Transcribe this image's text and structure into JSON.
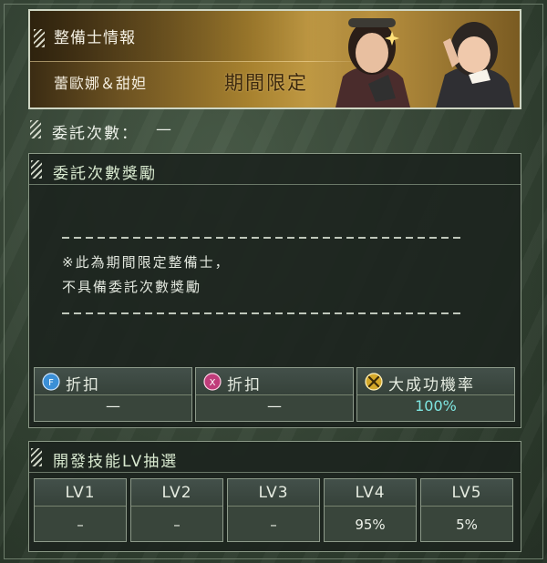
{
  "header": {
    "title": "整備士情報",
    "name": "蕾歐娜＆甜妲",
    "limited_tag": "期間限定"
  },
  "commission": {
    "label": "委託次數：",
    "value": "—"
  },
  "reward": {
    "title": "委託次數獎勵",
    "note_line1": "※此為期間限定整備士，",
    "note_line2": "不具備委託次數獎勵",
    "perks": [
      {
        "icon": "fp-discount-icon",
        "label": "折扣",
        "value": "—",
        "icon_color": "#3b8fd6"
      },
      {
        "icon": "fx-discount-icon",
        "label": "折扣",
        "value": "—",
        "icon_color": "#c03c7a"
      },
      {
        "icon": "tools-success-icon",
        "label": "大成功機率",
        "value": "100%",
        "icon_color": "#d4a82a"
      }
    ]
  },
  "skill_lottery": {
    "title": "開發技能LV抽選",
    "levels": [
      {
        "label": "LV1",
        "value": "–"
      },
      {
        "label": "LV2",
        "value": "–"
      },
      {
        "label": "LV3",
        "value": "–"
      },
      {
        "label": "LV4",
        "value": "95%"
      },
      {
        "label": "LV5",
        "value": "5%"
      }
    ]
  },
  "colors": {
    "banner_gold": "#c9a24b",
    "panel_bg": "#1c241e",
    "accent_teal": "#7ee6e1"
  }
}
